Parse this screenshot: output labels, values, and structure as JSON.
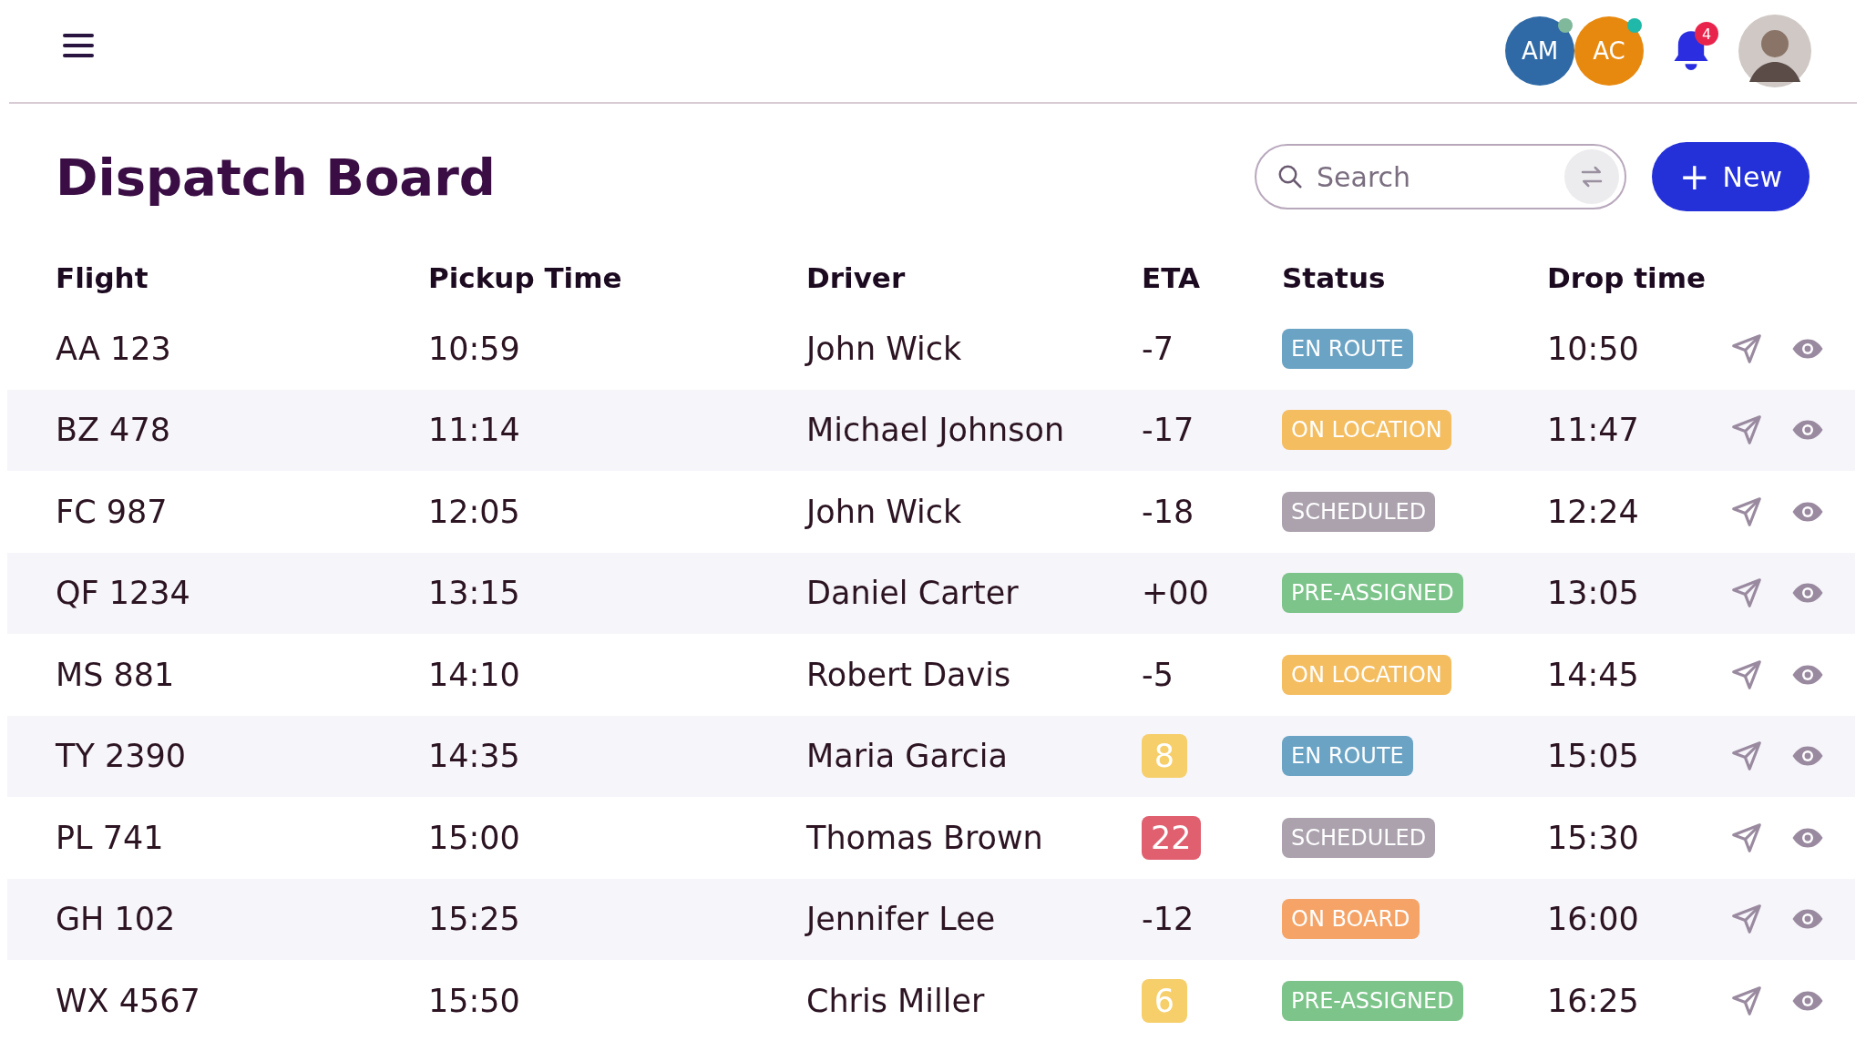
{
  "header": {
    "avatars": [
      {
        "initials": "AM",
        "color": "#2f6aa6",
        "status_dot": {
          "color": "#7fb89a"
        }
      },
      {
        "initials": "AC",
        "color": "#e8890f",
        "status_dot": {
          "color": "#20b8a8"
        }
      }
    ],
    "notifications": "4"
  },
  "page": {
    "title": "Dispatch Board",
    "search": {
      "placeholder": "Search"
    },
    "new_button": "New",
    "new_icon": "+"
  },
  "table": {
    "columns": [
      "Flight",
      "Pickup Time",
      "Driver",
      "ETA",
      "Status",
      "Drop time"
    ],
    "rows": [
      {
        "flight": "AA 123",
        "pickup": "10:59",
        "driver": "John Wick",
        "eta": {
          "text": "-7",
          "kind": "plain"
        },
        "status": "EN ROUTE",
        "color": "#6aa3c4",
        "drop": "10:50"
      },
      {
        "flight": "BZ 478",
        "pickup": "11:14",
        "driver": "Michael Johnson",
        "eta": {
          "text": "-17",
          "kind": "plain"
        },
        "status": "ON LOCATION",
        "color": "#f4bd5f",
        "drop": "11:47"
      },
      {
        "flight": "FC 987",
        "pickup": "12:05",
        "driver": "John Wick",
        "eta": {
          "text": "-18",
          "kind": "plain"
        },
        "status": "SCHEDULED",
        "color": "#aba2ae",
        "drop": "12:24"
      },
      {
        "flight": "QF 1234",
        "pickup": "13:15",
        "driver": "Daniel Carter",
        "eta": {
          "text": "+00",
          "kind": "plain"
        },
        "status": "PRE-ASSIGNED",
        "color": "#7cc48a",
        "drop": "13:05"
      },
      {
        "flight": "MS 881",
        "pickup": "14:10",
        "driver": "Robert Davis",
        "eta": {
          "text": "-5",
          "kind": "plain"
        },
        "status": "ON LOCATION",
        "color": "#f4bd5f",
        "drop": "14:45"
      },
      {
        "flight": "TY 2390",
        "pickup": "14:35",
        "driver": "Maria Garcia",
        "eta": {
          "text": "8",
          "kind": "warning"
        },
        "status": "EN ROUTE",
        "color": "#6aa3c4",
        "drop": "15:05"
      },
      {
        "flight": "PL 741",
        "pickup": "15:00",
        "driver": "Thomas Brown",
        "eta": {
          "text": "22",
          "kind": "danger"
        },
        "status": "SCHEDULED",
        "color": "#aba2ae",
        "drop": "15:30"
      },
      {
        "flight": "GH 102",
        "pickup": "15:25",
        "driver": "Jennifer Lee",
        "eta": {
          "text": "-12",
          "kind": "plain"
        },
        "status": "ON BOARD",
        "color": "#f5a366",
        "drop": "16:00"
      },
      {
        "flight": "WX 4567",
        "pickup": "15:50",
        "driver": "Chris Miller",
        "eta": {
          "text": "6",
          "kind": "warning"
        },
        "status": "PRE-ASSIGNED",
        "color": "#7cc48a",
        "drop": "16:25"
      }
    ]
  }
}
